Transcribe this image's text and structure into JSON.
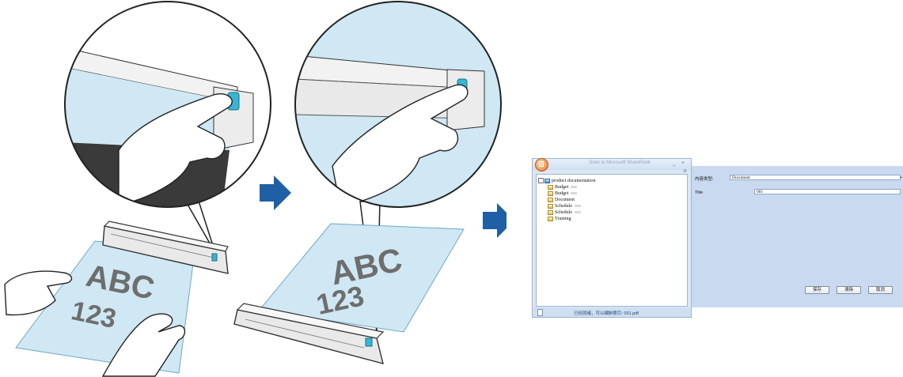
{
  "illustration": {
    "sheet1_text": [
      "ABC",
      "123"
    ],
    "sheet2_text": [
      "ABC",
      "123"
    ],
    "colors": {
      "paper": "#cfe8f3",
      "arrow": "#1f5fa6",
      "scanner_button": "#36b6d6"
    }
  },
  "sharepoint": {
    "title": "Scan to Microsoft SharePoint",
    "controls": {
      "minimize": "_",
      "close": "×",
      "pin": "⊕"
    },
    "tree": {
      "root": "product documentation",
      "items": [
        "Budget",
        "Budget",
        "Document",
        "Schedule",
        "Schedule",
        "Training"
      ]
    },
    "status_text": "已经就绪，可以编制索引:  001.pdf"
  },
  "properties": {
    "content_type_label": "内容类型:",
    "content_type_value": "Document",
    "title_label": "Title",
    "title_value": "001",
    "buttons": {
      "save": "保存",
      "clear": "清除",
      "cancel": "取消"
    }
  }
}
